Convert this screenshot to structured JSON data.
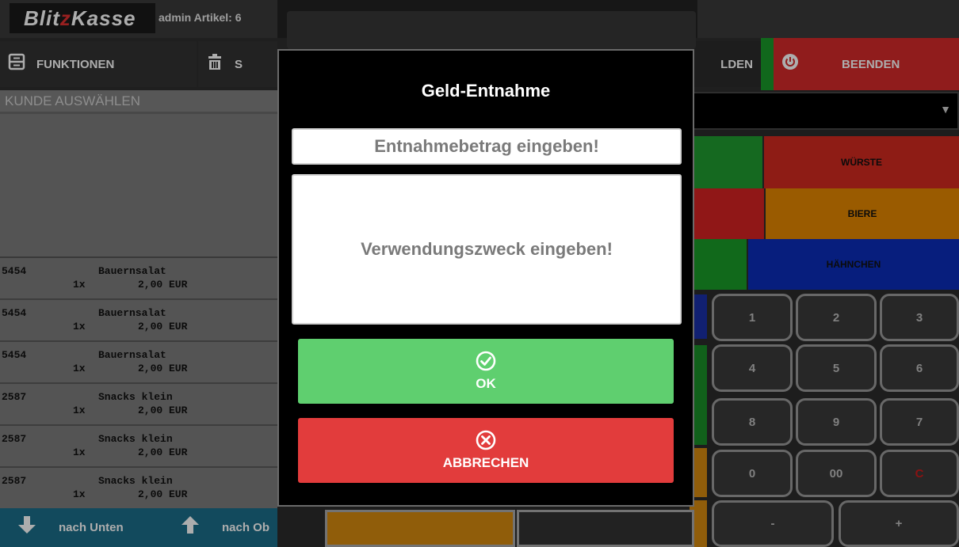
{
  "header": {
    "logo": {
      "part1": "Blit",
      "part2": "z",
      "part3": "Kasse"
    },
    "info": "admin Artikel: 6"
  },
  "toolbar": {
    "functions_label": "FUNKTIONEN",
    "second_label": "S",
    "fields_label": "LDEN",
    "end_label": "BEENDEN"
  },
  "customer": {
    "placeholder": "KUNDE AUSWÄHLEN"
  },
  "order_items": [
    {
      "code": "5454",
      "name": "Bauernsalat",
      "qty": "1x",
      "price": "2,00 EUR"
    },
    {
      "code": "5454",
      "name": "Bauernsalat",
      "qty": "1x",
      "price": "2,00 EUR"
    },
    {
      "code": "5454",
      "name": "Bauernsalat",
      "qty": "1x",
      "price": "2,00 EUR"
    },
    {
      "code": "2587",
      "name": "Snacks klein",
      "qty": "1x",
      "price": "2,00 EUR"
    },
    {
      "code": "2587",
      "name": "Snacks klein",
      "qty": "1x",
      "price": "2,00 EUR"
    },
    {
      "code": "2587",
      "name": "Snacks klein",
      "qty": "1x",
      "price": "2,00 EUR"
    }
  ],
  "bottom_nav": {
    "down_label": "nach Unten",
    "up_label": "nach Ob"
  },
  "categories": {
    "wuerste": "WÜRSTE",
    "biere": "BIERE",
    "haehnchen": "HÄHNCHEN"
  },
  "numpad": {
    "row1": [
      "1",
      "2",
      "3"
    ],
    "row2": [
      "4",
      "5",
      "6"
    ],
    "row3": [
      "8",
      "9",
      "7"
    ],
    "row4": [
      "0",
      "00",
      "C"
    ],
    "row5": [
      "-",
      "+"
    ]
  },
  "dialog": {
    "title": "Geld-Entnahme",
    "amount_placeholder": "Entnahmebetrag eingeben!",
    "purpose_placeholder": "Verwendungszweck eingeben!",
    "ok_label": "OK",
    "cancel_label": "ABBRECHEN"
  },
  "colors": {
    "accent_green": "#5fcf6f",
    "accent_red": "#e23c3c",
    "nav_teal": "#1b6e89",
    "end_red": "#d42a2a"
  }
}
